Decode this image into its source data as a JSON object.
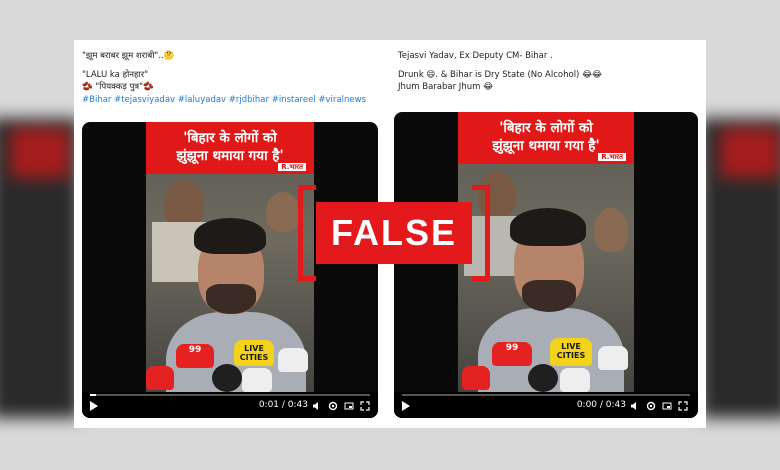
{
  "left_post": {
    "lines": [
      "\"झूम बराबर झूम शराबी\"..🤔",
      "",
      "\"LALU ka होनहार\"",
      "  🫘 \"पियक्कड़ पुत्र\"🫘"
    ],
    "hashtags": "#Bihar #tejasviyadav #laluyadav #rjdbihar #instareel #viralnews",
    "video": {
      "headline_line1": "'बिहार के लोगों को",
      "headline_line2": "झुंझूना थमाया गया है'",
      "channel": "R.भारत",
      "time": "0:01 / 0:43",
      "progress": 0.02,
      "mic_labels": [
        "99",
        "LIVE CITIES"
      ]
    }
  },
  "right_post": {
    "lines": [
      "Tejasvi Yadav, Ex Deputy CM- Bihar .",
      "",
      "Drunk 😄. & Bihar is Dry State (No Alcohol) 😂😂",
      "Jhum Barabar Jhum 😂"
    ],
    "video": {
      "headline_line1": "'बिहार के लोगों को",
      "headline_line2": "झुंझूना थमाया गया है'",
      "channel": "R.भारत",
      "time": "0:00 / 0:43",
      "progress": 0.0,
      "mic_labels": [
        "99",
        "LIVE CITIES"
      ]
    }
  },
  "stamp": {
    "label": "FALSE",
    "color": "#e3191c"
  },
  "icons": [
    "play-icon",
    "volume-icon",
    "settings-icon",
    "pip-icon",
    "fullscreen-icon"
  ]
}
